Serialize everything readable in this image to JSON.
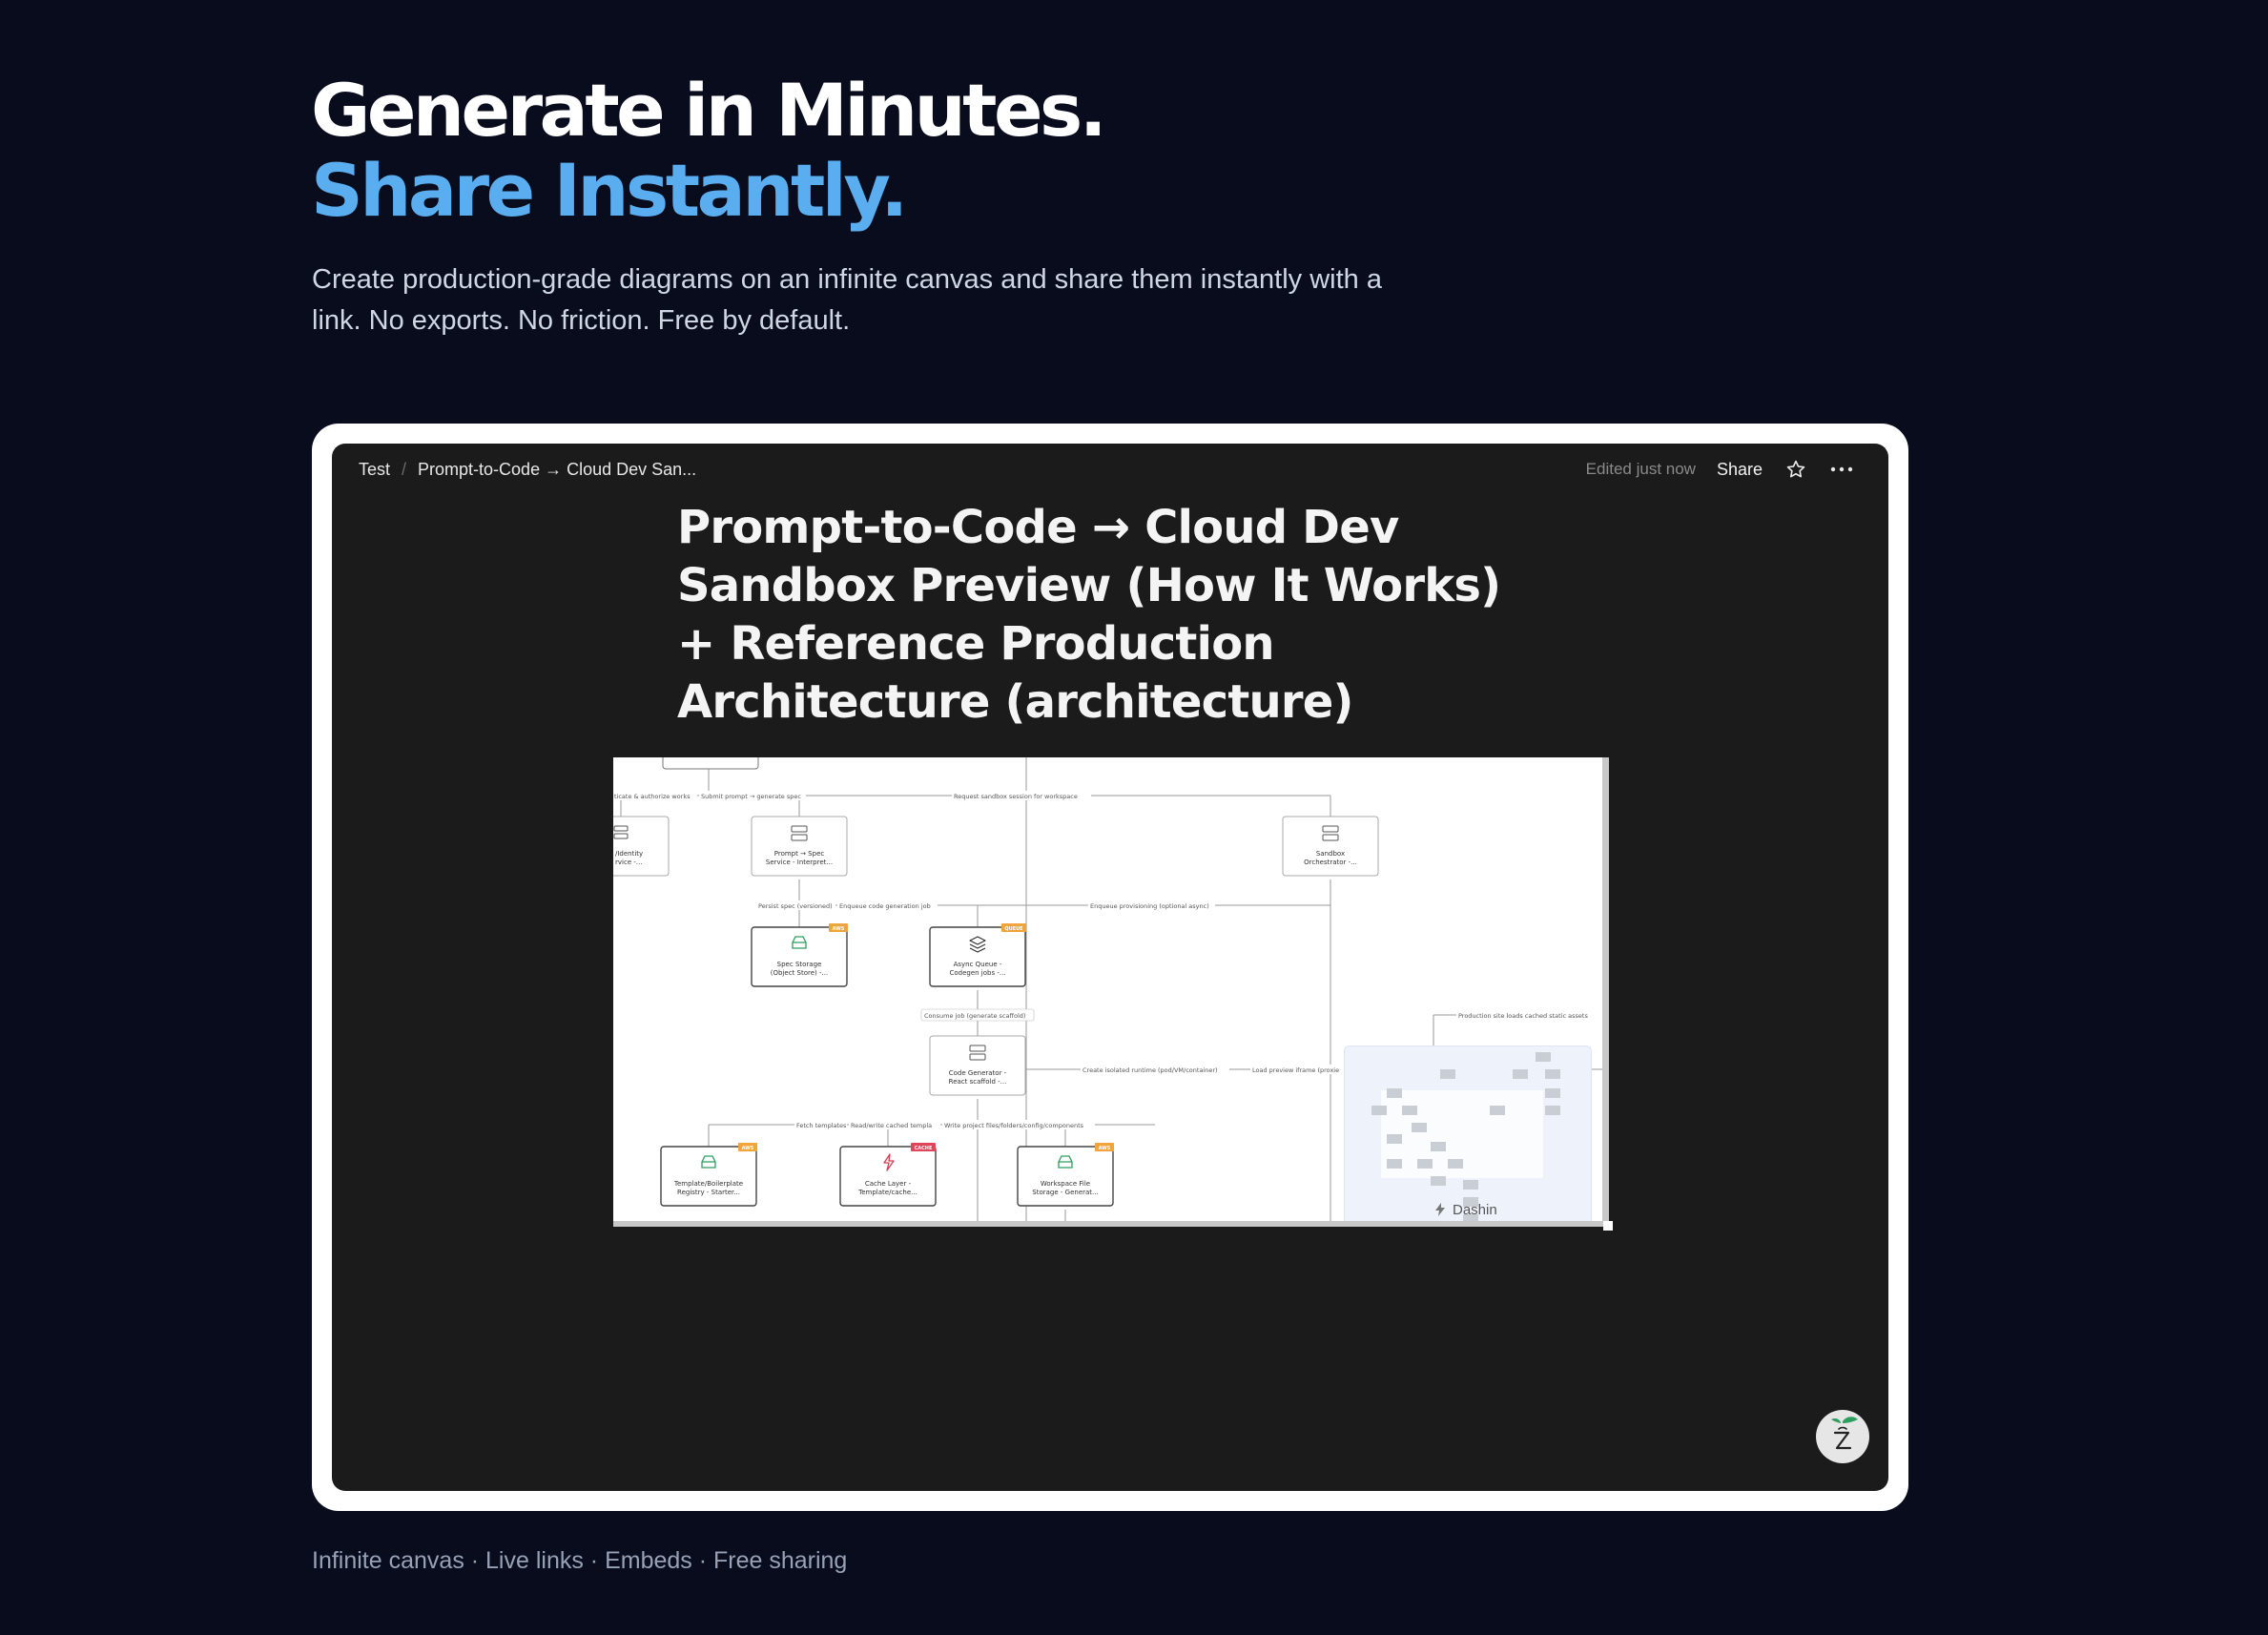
{
  "hero": {
    "title_line1": "Generate in Minutes.",
    "title_line2": "Share Instantly.",
    "subtitle": "Create production-grade diagrams on an infinite canvas and share them instantly with a link. No exports. No friction. Free by default."
  },
  "app": {
    "breadcrumb": {
      "root": "Test",
      "separator": "/",
      "current": "Prompt-to-Code → Cloud Dev San..."
    },
    "edited_status": "Edited just now",
    "share_label": "Share",
    "doc_title": "Prompt-to-Code → Cloud Dev Sandbox Preview (How It Works) + Reference Production Architecture (architecture)",
    "brand_badge": "Dashin"
  },
  "diagram": {
    "nodes": [
      {
        "id": "identity",
        "line1": "/Identity",
        "line2": "rvice -..."
      },
      {
        "id": "prompt-spec",
        "line1": "Prompt → Spec",
        "line2": "Service - Interpret..."
      },
      {
        "id": "sandbox-orch",
        "line1": "Sandbox",
        "line2": "Orchestrator -..."
      },
      {
        "id": "spec-storage",
        "line1": "Spec Storage",
        "line2": "(Object Store) -...",
        "tag": "AWS"
      },
      {
        "id": "async-queue",
        "line1": "Async Queue -",
        "line2": "Codegen jobs -...",
        "tag": "QUEUE"
      },
      {
        "id": "code-gen",
        "line1": "Code Generator -",
        "line2": "React scaffold -..."
      },
      {
        "id": "template-registry",
        "line1": "Template/Boilerplate",
        "line2": "Registry - Starter...",
        "tag": "AWS"
      },
      {
        "id": "cache-layer",
        "line1": "Cache Layer -",
        "line2": "Template/cache...",
        "tag": "CACHE"
      },
      {
        "id": "workspace-storage",
        "line1": "Workspace File",
        "line2": "Storage - Generat...",
        "tag": "AWS"
      }
    ],
    "edges": [
      "ticate & authorize works",
      "Submit prompt → generate spec",
      "Request sandbox session for workspace",
      "Persist spec (versioned)",
      "Enqueue code generation job",
      "Enqueue provisioning (optional async)",
      "Consume job (generate scaffold)",
      "Create isolated runtime (pod/VM/container)",
      "Load preview iframe (proxie",
      "Production site loads cached static assets",
      "Fetch templates",
      "Read/write cached templa",
      "Write project files/folders/config/components"
    ]
  },
  "tagline": "Infinite canvas · Live links · Embeds · Free sharing",
  "colors": {
    "background": "#080c1d",
    "accent": "#5aaef0",
    "app_surface": "#1b1b1b",
    "tag_aws": "#f0a43a",
    "tag_cache": "#e0455a",
    "icon_storage": "#2e9e5e",
    "icon_cache": "#d93a4f"
  }
}
